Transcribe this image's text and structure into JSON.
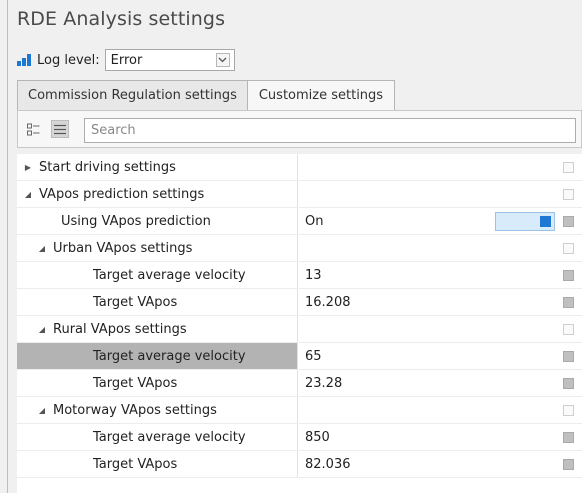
{
  "window": {
    "title": "RDE Analysis settings"
  },
  "log": {
    "label": "Log level:",
    "value": "Error"
  },
  "tabs": [
    {
      "label": "Commission Regulation settings",
      "active": false
    },
    {
      "label": "Customize settings",
      "active": true
    }
  ],
  "toolbar": {
    "search_placeholder": "Search"
  },
  "grid": {
    "rows": [
      {
        "name": "Start driving settings",
        "value": "",
        "depth": 0,
        "expander": "collapsed",
        "marker": "empty"
      },
      {
        "name": "VApos prediction settings",
        "value": "",
        "depth": 0,
        "expander": "expanded",
        "marker": "empty"
      },
      {
        "name": "Using VApos prediction",
        "value": "On",
        "depth": 2,
        "expander": "",
        "marker": "filled",
        "toggle": true
      },
      {
        "name": "Urban VApos settings",
        "value": "",
        "depth": 1,
        "expander": "expanded",
        "marker": "empty"
      },
      {
        "name": "Target average velocity",
        "value": "13",
        "depth": 3,
        "expander": "",
        "marker": "filled"
      },
      {
        "name": "Target VApos",
        "value": "16.208",
        "depth": 3,
        "expander": "",
        "marker": "filled"
      },
      {
        "name": "Rural VApos settings",
        "value": "",
        "depth": 1,
        "expander": "expanded",
        "marker": "empty"
      },
      {
        "name": "Target average velocity",
        "value": "65",
        "depth": 3,
        "expander": "",
        "marker": "filled",
        "selected": true
      },
      {
        "name": "Target VApos",
        "value": "23.28",
        "depth": 3,
        "expander": "",
        "marker": "filled"
      },
      {
        "name": "Motorway VApos settings",
        "value": "",
        "depth": 1,
        "expander": "expanded",
        "marker": "empty"
      },
      {
        "name": "Target average velocity",
        "value": "850",
        "depth": 3,
        "expander": "",
        "marker": "filled"
      },
      {
        "name": "Target VApos",
        "value": "82.036",
        "depth": 3,
        "expander": "",
        "marker": "filled"
      }
    ]
  },
  "colors": {
    "accent": "#1e77d3",
    "selected_row": "#b3b3b3",
    "toggle_bg": "#d8ebfb"
  },
  "icons": {
    "log_level": "bar-chart-icon",
    "dropdown": "chevron-down-icon",
    "categorized": "categorized-view-icon",
    "alphabetical": "list-view-icon",
    "collapsed": "triangle-right-icon",
    "expanded": "triangle-down-icon"
  }
}
